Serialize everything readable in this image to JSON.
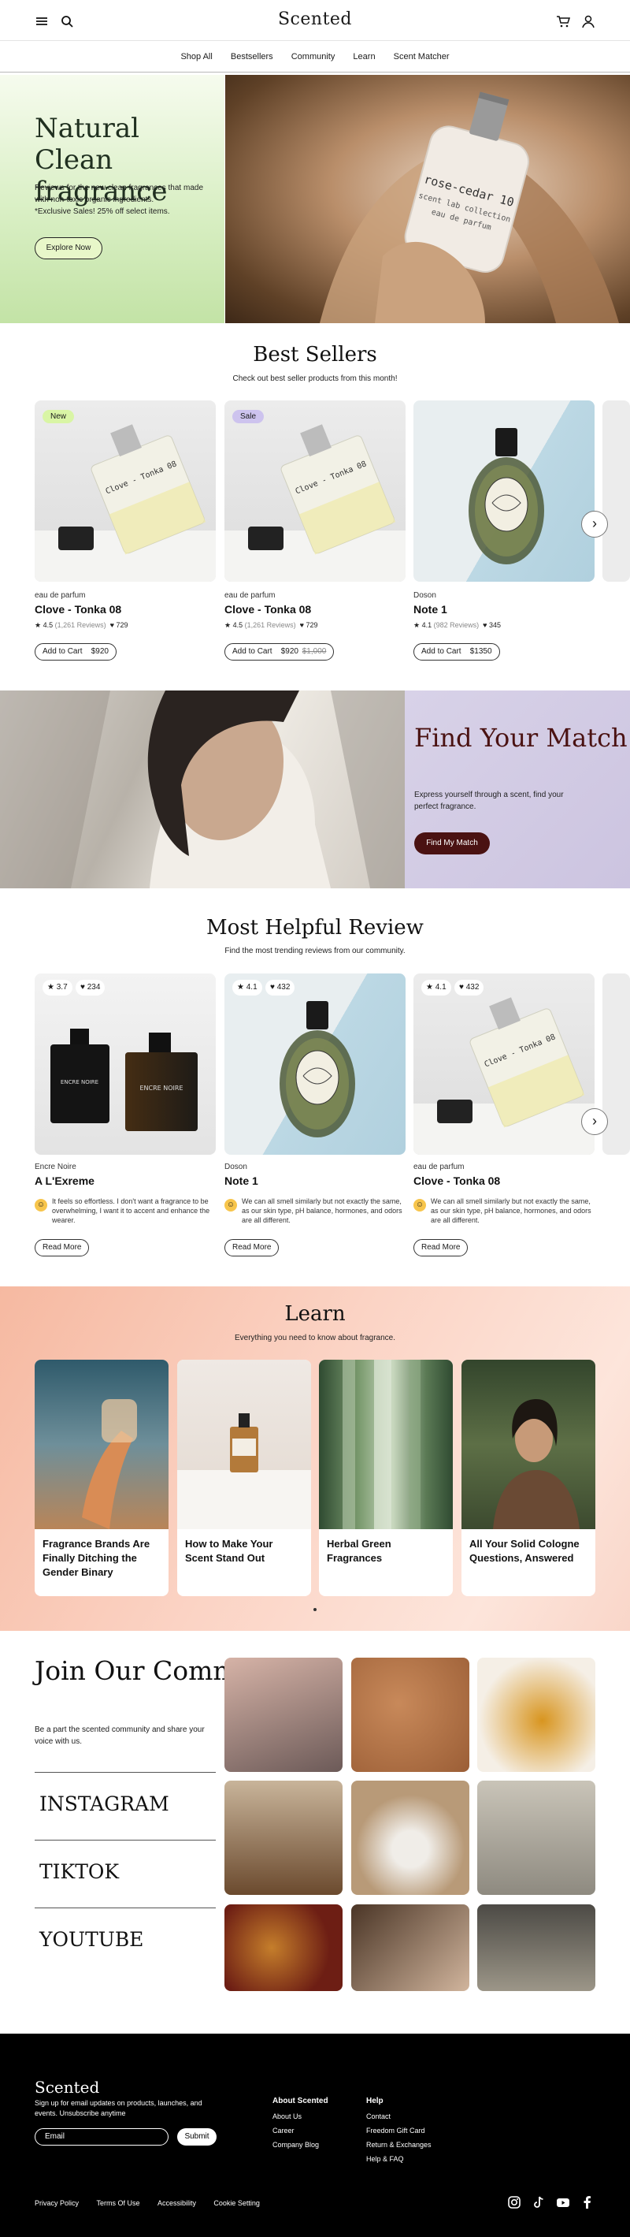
{
  "header": {
    "logo": "Scented",
    "menu_icon": "hamburger-menu-icon",
    "search_icon": "search-icon",
    "cart_icon": "cart-icon",
    "account_icon": "user-icon"
  },
  "nav": [
    "Shop All",
    "Bestsellers",
    "Community",
    "Learn",
    "Scent Matcher"
  ],
  "hero": {
    "title": "Natural Clean fragrance",
    "body": "Reviews for the new clean fragrances that made with non-toxic organic ingredients.",
    "promo": "*Exclusive Sales! 25% off select items.",
    "cta": "Explore Now",
    "bottle_label_line1": "rose-cedar 10",
    "bottle_label_line2": "scent lab collection",
    "bottle_label_line3": "eau de parfum"
  },
  "best_sellers": {
    "title": "Best Sellers",
    "subtitle": "Check out best seller products from this month!",
    "products": [
      {
        "badge": "New",
        "brand": "eau de parfum",
        "name": "Clove - Tonka 08",
        "rating": "4.5",
        "reviews": "(1,261 Reviews)",
        "likes": "729",
        "cart": "Add to Cart",
        "price": "$920",
        "old_price": ""
      },
      {
        "badge": "Sale",
        "brand": "eau de parfum",
        "name": "Clove - Tonka 08",
        "rating": "4.5",
        "reviews": "(1,261 Reviews)",
        "likes": "729",
        "cart": "Add to Cart",
        "price": "$920",
        "old_price": "$1,000"
      },
      {
        "badge": "",
        "brand": "Doson",
        "name": "Note 1",
        "rating": "4.1",
        "reviews": "(982 Reviews)",
        "likes": "345",
        "cart": "Add to Cart",
        "price": "$1350",
        "old_price": ""
      }
    ],
    "bottle_label": "Clove - Tonka 08"
  },
  "find_match": {
    "title": "Find Your Match",
    "body": "Express yourself through a scent, find your perfect fragrance.",
    "cta": "Find My Match"
  },
  "reviews": {
    "title": "Most Helpful Review",
    "subtitle": "Find the most trending reviews from our community.",
    "items": [
      {
        "rating": "3.7",
        "likes": "234",
        "brand": "Encre Noire",
        "name": "A L'Exreme",
        "text": "It feels so effortless. I don't want a fragrance to be overwhelming, I want it to accent and enhance the wearer.",
        "cta": "Read More",
        "bottle_label": "ENCRE NOIRE"
      },
      {
        "rating": "4.1",
        "likes": "432",
        "brand": "Doson",
        "name": "Note 1",
        "text": "We can all smell similarly but not exactly the same, as our skin type, pH balance, hormones, and odors are all different.",
        "cta": "Read More"
      },
      {
        "rating": "4.1",
        "likes": "432",
        "brand": "eau de parfum",
        "name": "Clove - Tonka 08",
        "text": "We can all smell similarly but not exactly the same, as our skin type, pH balance, hormones, and odors are all different.",
        "cta": "Read More"
      }
    ]
  },
  "learn": {
    "title": "Learn",
    "subtitle": "Everything you need to know about fragrance.",
    "cards": [
      "Fragrance Brands Are Finally Ditching the Gender Binary",
      "How to Make Your Scent Stand Out",
      "Herbal Green Fragrances",
      "All Your Solid Cologne Questions, Answered"
    ]
  },
  "community": {
    "title": "Join Our Community",
    "body": "Be a part the scented community and share your voice with us.",
    "socials": [
      "INSTAGRAM",
      "TIKTOK",
      "YOUTUBE"
    ]
  },
  "footer": {
    "logo": "Scented",
    "signup_text": "Sign up for email updates on products, launches, and events. Unsubscribe anytime",
    "email_placeholder": "Email",
    "submit": "Submit",
    "about_title": "About Scented",
    "about_links": [
      "About Us",
      "Career",
      "Company Blog"
    ],
    "help_title": "Help",
    "help_links": [
      "Contact",
      "Freedom Gift Card",
      "Return & Exchanges",
      "Help & FAQ"
    ],
    "legal_links": [
      "Privacy Policy",
      "Terms Of Use",
      "Accessibility",
      "Cookie Setting"
    ],
    "social_icons": [
      "instagram-icon",
      "tiktok-icon",
      "youtube-icon",
      "facebook-icon"
    ]
  },
  "colors": {
    "hero_green": "#d9efc4",
    "find_match_lavender": "#d8d2e8",
    "accent_maroon": "#4a1212",
    "new_badge": "#d9f5a5",
    "sale_badge": "#cdc3ee",
    "learn_peach": "#f6b9a1"
  }
}
